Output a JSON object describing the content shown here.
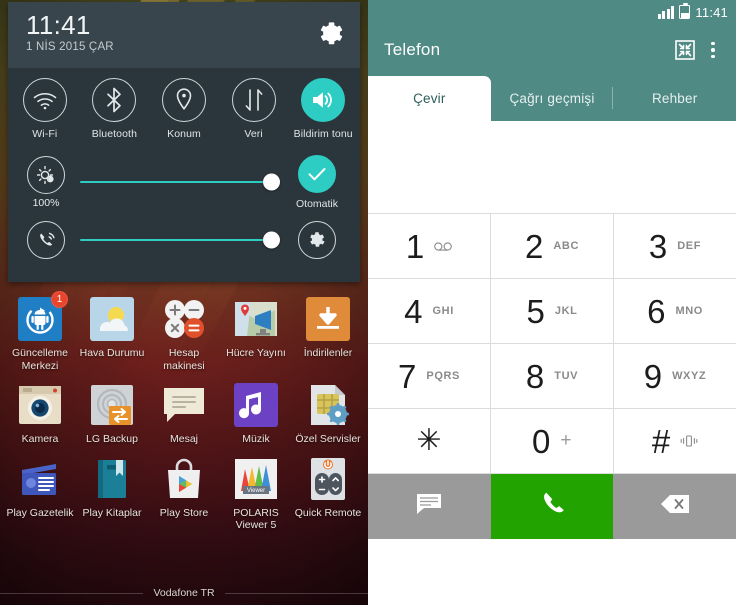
{
  "left": {
    "quick_settings": {
      "time": "11:41",
      "date": "1 NİS 2015 ÇAR",
      "settings_icon": "gear-icon",
      "toggles": [
        {
          "label": "Wi-Fi",
          "icon": "wifi-icon",
          "active": false
        },
        {
          "label": "Bluetooth",
          "icon": "bluetooth-icon",
          "active": false
        },
        {
          "label": "Konum",
          "icon": "location-pin-icon",
          "active": false
        },
        {
          "label": "Veri",
          "icon": "data-arrows-icon",
          "active": false
        },
        {
          "label": "Bildirim tonu",
          "icon": "speaker-icon",
          "active": true
        }
      ],
      "brightness": {
        "icon": "brightness-icon",
        "value_label": "100%",
        "slider_percent": 100,
        "auto_label": "Otomatik",
        "auto_icon": "check-icon",
        "auto_active": true
      },
      "volume": {
        "icon": "ringer-icon",
        "slider_percent": 100,
        "settings_icon": "gear-icon"
      }
    },
    "apps": [
      [
        {
          "label": "Güncelleme Merkezi",
          "icon": "android-update-icon",
          "badge": "1"
        },
        {
          "label": "Hava Durumu",
          "icon": "weather-icon",
          "badge": ""
        },
        {
          "label": "Hesap makinesi",
          "icon": "calculator-icon",
          "badge": ""
        },
        {
          "label": "Hücre Yayını",
          "icon": "cell-broadcast-icon",
          "badge": ""
        },
        {
          "label": "İndirilenler",
          "icon": "download-icon",
          "badge": ""
        }
      ],
      [
        {
          "label": "Kamera",
          "icon": "camera-icon",
          "badge": ""
        },
        {
          "label": "LG Backup",
          "icon": "backup-icon",
          "badge": ""
        },
        {
          "label": "Mesaj",
          "icon": "message-icon",
          "badge": ""
        },
        {
          "label": "Müzik",
          "icon": "music-note-icon",
          "badge": ""
        },
        {
          "label": "Özel Servisler",
          "icon": "sim-settings-icon",
          "badge": ""
        }
      ],
      [
        {
          "label": "Play Gazetelik",
          "icon": "play-newsstand-icon",
          "badge": ""
        },
        {
          "label": "Play Kitaplar",
          "icon": "play-books-icon",
          "badge": ""
        },
        {
          "label": "Play Store",
          "icon": "play-store-icon",
          "badge": ""
        },
        {
          "label": "POLARIS Viewer 5",
          "icon": "polaris-viewer-icon",
          "badge": ""
        },
        {
          "label": "Quick Remote",
          "icon": "quick-remote-icon",
          "badge": ""
        }
      ]
    ],
    "carrier": "Vodafone TR"
  },
  "right": {
    "statusbar": {
      "time": "11:41",
      "signal_icon": "signal-bars-icon",
      "battery_icon": "battery-icon"
    },
    "appbar": {
      "title": "Telefon",
      "action_icon": "shrink-screen-icon",
      "overflow_icon": "overflow-menu-icon"
    },
    "tabs": [
      {
        "label": "Çevir",
        "active": true
      },
      {
        "label": "Çağrı geçmişi",
        "active": false
      },
      {
        "label": "Rehber",
        "active": false
      }
    ],
    "keypad": [
      [
        {
          "digit": "1",
          "sub": "",
          "icon": "voicemail-icon"
        },
        {
          "digit": "2",
          "sub": "ABC",
          "icon": ""
        },
        {
          "digit": "3",
          "sub": "DEF",
          "icon": ""
        }
      ],
      [
        {
          "digit": "4",
          "sub": "GHI",
          "icon": ""
        },
        {
          "digit": "5",
          "sub": "JKL",
          "icon": ""
        },
        {
          "digit": "6",
          "sub": "MNO",
          "icon": ""
        }
      ],
      [
        {
          "digit": "7",
          "sub": "PQRS",
          "icon": ""
        },
        {
          "digit": "8",
          "sub": "TUV",
          "icon": ""
        },
        {
          "digit": "9",
          "sub": "WXYZ",
          "icon": ""
        }
      ],
      [
        {
          "digit": "✳",
          "sub": "",
          "icon": ""
        },
        {
          "digit": "0",
          "sub": "+",
          "icon": ""
        },
        {
          "digit": "#",
          "sub": "",
          "icon": "vibrate-icon"
        }
      ]
    ],
    "bottom_bar": {
      "message_icon": "message-bubble-icon",
      "call_icon": "phone-handset-icon",
      "backspace_icon": "backspace-icon"
    }
  },
  "colors": {
    "teal_accent": "#2ecdc4",
    "appbar_teal": "#4f8a85",
    "panel_dark": "#2b363c",
    "panel_header": "#39454c",
    "call_green": "#22a300",
    "badge_red": "#e8452c"
  }
}
